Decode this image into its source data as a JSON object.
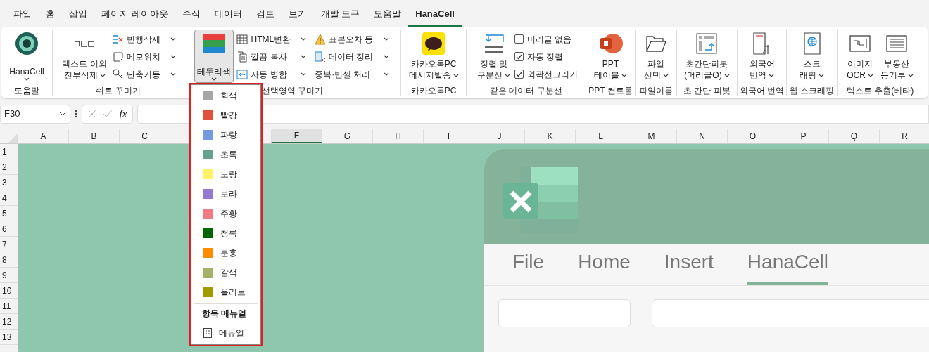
{
  "menu_tabs": [
    {
      "label": "파일",
      "selected": false
    },
    {
      "label": "홈",
      "selected": false
    },
    {
      "label": "삽입",
      "selected": false
    },
    {
      "label": "페이지 레이아웃",
      "selected": false
    },
    {
      "label": "수식",
      "selected": false
    },
    {
      "label": "데이터",
      "selected": false
    },
    {
      "label": "검토",
      "selected": false
    },
    {
      "label": "보기",
      "selected": false
    },
    {
      "label": "개발 도구",
      "selected": false
    },
    {
      "label": "도움말",
      "selected": false
    },
    {
      "label": "HanaCell",
      "selected": true
    }
  ],
  "ribbon": [
    {
      "label": "도움말",
      "items": [
        {
          "kind": "large",
          "lines": [
            "HanaCell"
          ],
          "pressed": false
        }
      ]
    },
    {
      "label": "쉬트 꾸미기",
      "items": [
        {
          "kind": "large",
          "lines": [
            "텍스트 이외",
            "전부삭제"
          ],
          "pressed": false
        },
        {
          "kind": "small",
          "label": "빈행삭제"
        },
        {
          "kind": "small",
          "label": "메모위치"
        },
        {
          "kind": "small",
          "label": "단축키등"
        }
      ]
    },
    {
      "label": "선택영역 꾸미기",
      "items": [
        {
          "kind": "large",
          "lines": [
            "테두리색"
          ],
          "pressed": true
        },
        {
          "kind": "small",
          "label": "HTML변환"
        },
        {
          "kind": "small",
          "label": "깔끔 복사"
        },
        {
          "kind": "small",
          "label": "자동 병합"
        },
        {
          "kind": "small",
          "label": "표본오차 등"
        },
        {
          "kind": "small",
          "label": "데이터 정리"
        },
        {
          "kind": "small",
          "label": "중복·빈셀 처리"
        }
      ]
    },
    {
      "label": "카카오톡PC",
      "items": [
        {
          "kind": "large",
          "lines": [
            "카카오톡PC",
            "메시지발송"
          ],
          "pressed": false
        }
      ]
    },
    {
      "label": "같은 데이터 구분선",
      "items": [
        {
          "kind": "large",
          "lines": [
            "정렬 및",
            "구분선"
          ],
          "pressed": false
        },
        {
          "kind": "check",
          "label": "머리글 없음",
          "checked": false
        },
        {
          "kind": "check",
          "label": "자동 정렬",
          "checked": true
        },
        {
          "kind": "check",
          "label": "외곽선그리기",
          "checked": true
        }
      ]
    },
    {
      "label": "PPT 컨트롤",
      "items": [
        {
          "kind": "large",
          "lines": [
            "PPT",
            "테이블"
          ],
          "pressed": false
        }
      ]
    },
    {
      "label": "파일이름",
      "items": [
        {
          "kind": "large",
          "lines": [
            "파일",
            "선택"
          ],
          "pressed": false
        }
      ]
    },
    {
      "label": "초 간단 피봇",
      "items": [
        {
          "kind": "large",
          "lines": [
            "초간단피봇",
            "(머리글O)"
          ],
          "pressed": false
        }
      ]
    },
    {
      "label": "외국어 번역",
      "items": [
        {
          "kind": "large",
          "lines": [
            "외국어",
            "번역"
          ],
          "pressed": false
        }
      ]
    },
    {
      "label": "웹 스크래핑",
      "items": [
        {
          "kind": "large",
          "lines": [
            "스크",
            "래핑"
          ],
          "pressed": false
        }
      ]
    },
    {
      "label": "텍스트 추출(베타)",
      "items": [
        {
          "kind": "large",
          "lines": [
            "이미지",
            "OCR"
          ],
          "pressed": false
        },
        {
          "kind": "large",
          "lines": [
            "부동산",
            "등기부"
          ],
          "pressed": false
        }
      ]
    }
  ],
  "formula_bar": {
    "name_box": "F30",
    "fx": "fx"
  },
  "columns": [
    {
      "label": "A",
      "selected": false
    },
    {
      "label": "B",
      "selected": false
    },
    {
      "label": "C",
      "selected": false
    },
    {
      "label": "F",
      "selected": true
    },
    {
      "label": "G",
      "selected": false
    },
    {
      "label": "H",
      "selected": false
    },
    {
      "label": "I",
      "selected": false
    },
    {
      "label": "J",
      "selected": false
    },
    {
      "label": "K",
      "selected": false
    },
    {
      "label": "L",
      "selected": false
    },
    {
      "label": "M",
      "selected": false
    },
    {
      "label": "N",
      "selected": false
    },
    {
      "label": "O",
      "selected": false
    },
    {
      "label": "P",
      "selected": false
    },
    {
      "label": "Q",
      "selected": false
    },
    {
      "label": "R",
      "selected": false
    }
  ],
  "rows": [
    "1",
    "2",
    "3",
    "4",
    "5",
    "6",
    "7",
    "8",
    "9",
    "10",
    "11",
    "12",
    "13"
  ],
  "color_menu": {
    "colors": [
      {
        "label": "회색",
        "color": "#a6a6a6"
      },
      {
        "label": "빨강",
        "color": "#e0533a"
      },
      {
        "label": "파랑",
        "color": "#7399e0"
      },
      {
        "label": "초록",
        "color": "#66a08e"
      },
      {
        "label": "노랑",
        "color": "#fff266"
      },
      {
        "label": "보라",
        "color": "#9479d1"
      },
      {
        "label": "주황",
        "color": "#f07b87"
      },
      {
        "label": "청록",
        "color": "#006400"
      },
      {
        "label": "분홍",
        "color": "#ff8c00"
      },
      {
        "label": "갈색",
        "color": "#a3b266"
      },
      {
        "label": "올리브",
        "color": "#a29a00"
      }
    ],
    "section_title": "항목 메뉴얼",
    "manual_item": "메뉴얼"
  },
  "sheet_image": {
    "tabs": [
      {
        "label": "File",
        "selected": false
      },
      {
        "label": "Home",
        "selected": false
      },
      {
        "label": "Insert",
        "selected": false
      },
      {
        "label": "HanaCell",
        "selected": true
      }
    ]
  }
}
